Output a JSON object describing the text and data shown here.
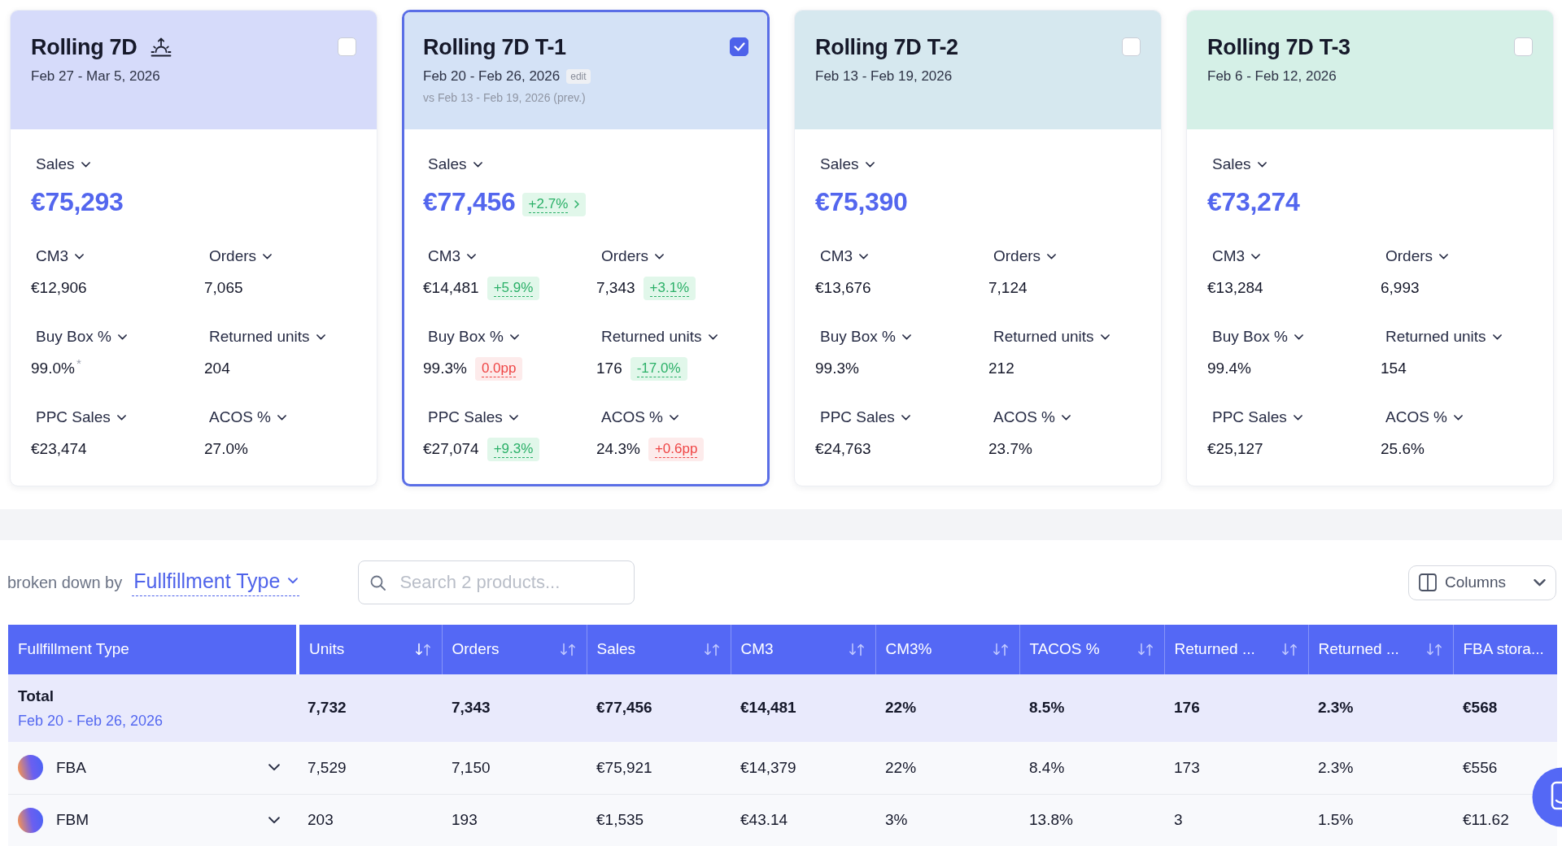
{
  "period_cards": [
    {
      "title": "Rolling 7D",
      "title_icon": true,
      "date_range": "Feb 27 - Mar 5, 2026",
      "color": "#d6dbfa",
      "checked": false,
      "primary_metric": {
        "label": "Sales",
        "value": "€75,293"
      },
      "metrics": [
        {
          "label": "CM3",
          "value": "€12,906"
        },
        {
          "label": "Orders",
          "value": "7,065"
        },
        {
          "label": "Buy Box %",
          "value": "99.0%$^{*}$"
        },
        {
          "label": "Returned units",
          "value": "204"
        },
        {
          "label": "PPC Sales",
          "value": "€23,474"
        },
        {
          "label": "ACOS %",
          "value": "27.0%"
        }
      ]
    },
    {
      "title": "Rolling 7D T-1",
      "title_icon": false,
      "date_range": "Feb 20 - Feb 26, 2026",
      "edit_label": "edit",
      "comparison": "vs Feb 13 - Feb 19, 2026 (prev.)",
      "color": "#d4e2f6",
      "checked": true,
      "primary_metric": {
        "label": "Sales",
        "value": "€77,456",
        "change": {
          "text": "+2.7%",
          "positive": true
        }
      },
      "metrics": [
        {
          "label": "CM3",
          "value": "€14,481",
          "change": {
            "text": "+5.9%",
            "positive": true
          }
        },
        {
          "label": "Orders",
          "value": "7,343",
          "change": {
            "text": "+3.1%",
            "positive": true
          }
        },
        {
          "label": "Buy Box %",
          "value": "99.3%",
          "change": {
            "text": "0.0pp",
            "positive": false
          }
        },
        {
          "label": "Returned units",
          "value": "176",
          "change": {
            "text": "-17.0%",
            "positive": true
          }
        },
        {
          "label": "PPC Sales",
          "value": "€27,074",
          "change": {
            "text": "+9.3%",
            "positive": true
          }
        },
        {
          "label": "ACOS %",
          "value": "24.3%",
          "change": {
            "text": "+0.6pp",
            "positive": false
          }
        }
      ]
    },
    {
      "title": "Rolling 7D T-2",
      "title_icon": false,
      "date_range": "Feb 13 - Feb 19, 2026",
      "color": "#d6e8ef",
      "checked": false,
      "primary_metric": {
        "label": "Sales",
        "value": "€75,390"
      },
      "metrics": [
        {
          "label": "CM3",
          "value": "€13,676"
        },
        {
          "label": "Orders",
          "value": "7,124"
        },
        {
          "label": "Buy Box %",
          "value": "99.3%"
        },
        {
          "label": "Returned units",
          "value": "212"
        },
        {
          "label": "PPC Sales",
          "value": "€24,763"
        },
        {
          "label": "ACOS %",
          "value": "23.7%"
        }
      ]
    },
    {
      "title": "Rolling 7D T-3",
      "title_icon": false,
      "date_range": "Feb 6 - Feb 12, 2026",
      "color": "#d5f0e7",
      "checked": false,
      "primary_metric": {
        "label": "Sales",
        "value": "€73,274"
      },
      "metrics": [
        {
          "label": "CM3",
          "value": "€13,284"
        },
        {
          "label": "Orders",
          "value": "6,993"
        },
        {
          "label": "Buy Box %",
          "value": "99.4%"
        },
        {
          "label": "Returned units",
          "value": "154"
        },
        {
          "label": "PPC Sales",
          "value": "€25,127"
        },
        {
          "label": "ACOS %",
          "value": "25.6%"
        }
      ]
    }
  ],
  "breakdown": {
    "prefix": "broken down by",
    "value": "Fullfillment Type"
  },
  "search": {
    "placeholder": "Search 2 products..."
  },
  "columns_button": {
    "label": "Columns"
  },
  "table": {
    "columns": [
      {
        "label": "Fullfillment Type",
        "sortable": false,
        "sorted": false
      },
      {
        "label": "Units",
        "sortable": true,
        "sorted": true
      },
      {
        "label": "Orders",
        "sortable": true,
        "sorted": false
      },
      {
        "label": "Sales",
        "sortable": true,
        "sorted": false
      },
      {
        "label": "CM3",
        "sortable": true,
        "sorted": false
      },
      {
        "label": "CM3%",
        "sortable": true,
        "sorted": false
      },
      {
        "label": "TACOS %",
        "sortable": true,
        "sorted": false
      },
      {
        "label": "Returned ...",
        "sortable": true,
        "sorted": false
      },
      {
        "label": "Returned ...",
        "sortable": true,
        "sorted": false
      },
      {
        "label": "FBA stora...",
        "sortable": false,
        "sorted": false
      }
    ],
    "total": {
      "cells": [
        "Total",
        "7,732",
        "7,343",
        "€77,456",
        "€14,481",
        "22%",
        "8.5%",
        "176",
        "2.3%",
        "€568"
      ],
      "date_range": "Feb 20 - Feb 26, 2026"
    },
    "rows": [
      {
        "expanded": false,
        "cells": [
          "FBA",
          "7,529",
          "7,150",
          "€75,921",
          "€14,379",
          "22%",
          "8.4%",
          "173",
          "2.3%",
          "€556"
        ]
      },
      {
        "expanded": false,
        "cells": [
          "FBM",
          "203",
          "193",
          "€1,535",
          "€43.14",
          "3%",
          "13.8%",
          "3",
          "1.5%",
          "€11.62"
        ]
      }
    ]
  }
}
